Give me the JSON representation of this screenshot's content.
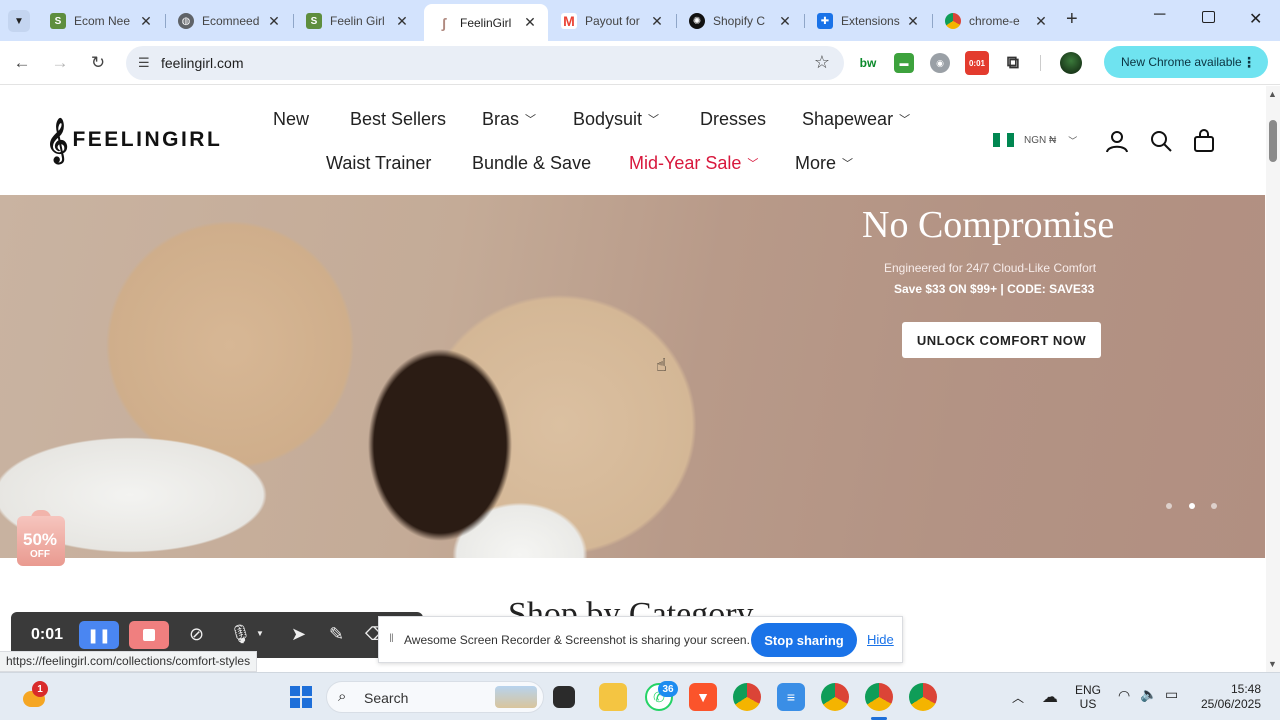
{
  "tabs": [
    {
      "title": "Ecom Nee",
      "icon": "shopify-icon",
      "color": "#5e8e3e"
    },
    {
      "title": "Ecomneed",
      "icon": "globe-icon",
      "color": "#5f6368"
    },
    {
      "title": "Feelin Girl",
      "icon": "shopify-icon",
      "color": "#5e8e3e"
    },
    {
      "title": "FeelinGirl",
      "icon": "feelingirl-icon",
      "color": "#c9a9a0",
      "active": true
    },
    {
      "title": "Payout for",
      "icon": "gmail-icon",
      "color": "#ea4335"
    },
    {
      "title": "Shopify C",
      "icon": "chatgpt-icon",
      "color": "#111111"
    },
    {
      "title": "Extensions",
      "icon": "puzzle-icon",
      "color": "#1a73e8"
    },
    {
      "title": "chrome-e",
      "icon": "chrome-icon",
      "color": "#db4437"
    }
  ],
  "omnibox": {
    "url": "feelingirl.com"
  },
  "extensions": {
    "timer_badge": "0:01"
  },
  "update_button": {
    "label": "New Chrome available"
  },
  "site": {
    "logo_mark": "𝄞",
    "logo_text": "FEELINGIRL",
    "nav_row1": [
      {
        "label": "New",
        "dropdown": false
      },
      {
        "label": "Best Sellers",
        "dropdown": false
      },
      {
        "label": "Bras",
        "dropdown": true
      },
      {
        "label": "Bodysuit",
        "dropdown": true
      },
      {
        "label": "Dresses",
        "dropdown": false
      },
      {
        "label": "Shapewear",
        "dropdown": true
      }
    ],
    "nav_row2": [
      {
        "label": "Waist Trainer",
        "dropdown": false
      },
      {
        "label": "Bundle & Save",
        "dropdown": false
      },
      {
        "label": "Mid-Year Sale",
        "dropdown": true,
        "highlight": true
      },
      {
        "label": "More",
        "dropdown": true
      }
    ],
    "currency": "NGN ₦",
    "sale_color": "#d8173c"
  },
  "hero": {
    "title": "No Compromise",
    "subtitle": "Engineered for 24/7 Cloud-Like Comfort",
    "offer": "Save $33 ON $99+  |  CODE: SAVE33",
    "cta": "UNLOCK COMFORT NOW",
    "slides": 3,
    "active_slide": 2
  },
  "badge": {
    "percent": "50%",
    "label": "OFF"
  },
  "section_title": "Shop by Category",
  "recorder": {
    "time": "0:01"
  },
  "share_bar": {
    "message": "Awesome Screen Recorder & Screenshot is sharing your screen.",
    "stop_label": "Stop sharing",
    "hide_label": "Hide"
  },
  "status_url": "https://feelingirl.com/collections/comfort-styles",
  "taskbar": {
    "weather_badge": "1",
    "search_label": "Search",
    "whatsapp_badge": "36",
    "language": "ENG",
    "region": "US",
    "time": "15:48",
    "date": "25/06/2025"
  }
}
